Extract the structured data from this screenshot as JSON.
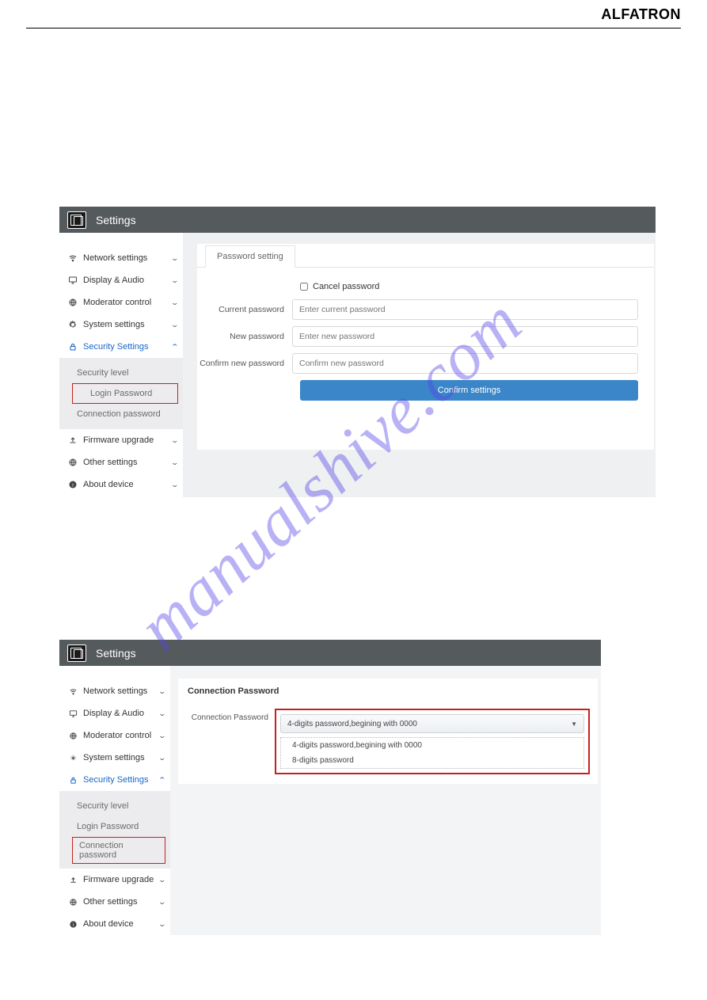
{
  "brand": "ALFATRON",
  "watermark": "manualshive.com",
  "panel1": {
    "title": "Settings",
    "sidebar": {
      "items": [
        {
          "label": "Network settings",
          "icon": "wifi",
          "expanded": false
        },
        {
          "label": "Display & Audio",
          "icon": "monitor",
          "expanded": false
        },
        {
          "label": "Moderator control",
          "icon": "globe",
          "expanded": false
        },
        {
          "label": "System settings",
          "icon": "gear",
          "expanded": false
        },
        {
          "label": "Security Settings",
          "icon": "lock",
          "expanded": true,
          "sub": [
            {
              "label": "Security level"
            },
            {
              "label": "Login Password",
              "highlight": true
            },
            {
              "label": "Connection password"
            }
          ]
        },
        {
          "label": "Firmware upgrade",
          "icon": "upload",
          "expanded": false
        },
        {
          "label": "Other settings",
          "icon": "globe",
          "expanded": false
        },
        {
          "label": "About device",
          "icon": "info",
          "expanded": false
        }
      ]
    },
    "tab": "Password setting",
    "cancel_label": "Cancel password",
    "rows": {
      "current": {
        "label": "Current password",
        "placeholder": "Enter current password"
      },
      "new": {
        "label": "New password",
        "placeholder": "Enter new password"
      },
      "confirm": {
        "label": "Confirm new password",
        "placeholder": "Confirm new password"
      }
    },
    "confirm_btn": "Confirm settings"
  },
  "panel2": {
    "title": "Settings",
    "sidebar": {
      "items": [
        {
          "label": "Network settings",
          "icon": "wifi",
          "expanded": false
        },
        {
          "label": "Display & Audio",
          "icon": "monitor",
          "expanded": false
        },
        {
          "label": "Moderator control",
          "icon": "globe",
          "expanded": false
        },
        {
          "label": "System settings",
          "icon": "gear",
          "expanded": false
        },
        {
          "label": "Security Settings",
          "icon": "lock",
          "expanded": true,
          "sub": [
            {
              "label": "Security level"
            },
            {
              "label": "Login Password"
            },
            {
              "label": "Connection password",
              "highlight": true
            }
          ]
        },
        {
          "label": "Firmware upgrade",
          "icon": "upload",
          "expanded": false
        },
        {
          "label": "Other settings",
          "icon": "globe",
          "expanded": false
        },
        {
          "label": "About device",
          "icon": "info",
          "expanded": false
        }
      ]
    },
    "section_title": "Connection Password",
    "conn_label": "Connection Password",
    "selected": "4-digits password,begining with 0000",
    "options": [
      "4-digits password,begining with 0000",
      "8-digits password"
    ]
  }
}
